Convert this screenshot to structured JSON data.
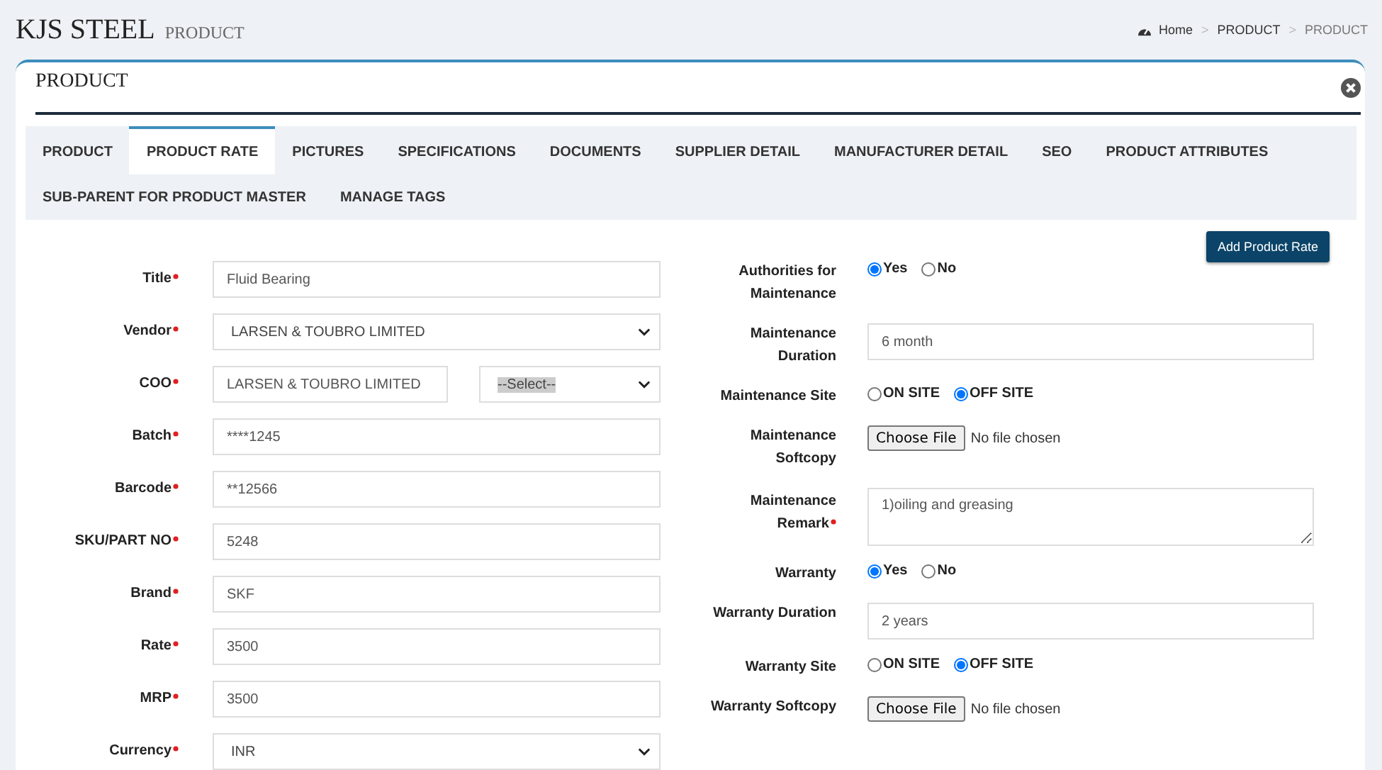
{
  "header": {
    "title": "KJS STEEL",
    "subtitle": "PRODUCT"
  },
  "breadcrumb": {
    "separator": ">",
    "items": [
      {
        "label": "Home",
        "kind": "home"
      },
      {
        "label": "PRODUCT",
        "kind": "link"
      },
      {
        "label": "PRODUCT",
        "kind": "current"
      }
    ]
  },
  "panel": {
    "title": "PRODUCT"
  },
  "tabs": [
    {
      "label": "PRODUCT",
      "selected": false
    },
    {
      "label": "PRODUCT RATE",
      "selected": true
    },
    {
      "label": "PICTURES",
      "selected": false
    },
    {
      "label": "SPECIFICATIONS",
      "selected": false
    },
    {
      "label": "DOCUMENTS",
      "selected": false
    },
    {
      "label": "SUPPLIER DETAIL",
      "selected": false
    },
    {
      "label": "MANUFACTURER DETAIL",
      "selected": false
    },
    {
      "label": "SEO",
      "selected": false
    },
    {
      "label": "PRODUCT ATTRIBUTES",
      "selected": false
    },
    {
      "label": "SUB-PARENT FOR PRODUCT MASTER",
      "selected": false
    },
    {
      "label": "MANAGE TAGS",
      "selected": false
    }
  ],
  "add_button": "Add Product Rate",
  "left_fields": [
    {
      "label": "Title",
      "required": true,
      "kind": "text",
      "value": "Fluid Bearing"
    },
    {
      "label": "Vendor",
      "required": true,
      "kind": "select",
      "value": "LARSEN & TOUBRO LIMITED"
    },
    {
      "label": "COO",
      "required": true,
      "kind": "text_select",
      "value": "LARSEN & TOUBRO LIMITED",
      "select_value": "--Select--"
    },
    {
      "label": "Batch",
      "required": true,
      "kind": "text",
      "value": "****1245"
    },
    {
      "label": "Barcode",
      "required": true,
      "kind": "text",
      "value": "**12566"
    },
    {
      "label": "SKU/PART NO",
      "required": true,
      "kind": "text",
      "value": "5248"
    },
    {
      "label": "Brand",
      "required": true,
      "kind": "text",
      "value": "SKF"
    },
    {
      "label": "Rate",
      "required": true,
      "kind": "text",
      "value": "3500"
    },
    {
      "label": "MRP",
      "required": true,
      "kind": "text",
      "value": "3500"
    },
    {
      "label": "Currency",
      "required": true,
      "kind": "select",
      "value": "INR"
    }
  ],
  "right_fields": [
    {
      "label": "Authorities for Maintenance",
      "required": false,
      "kind": "radio",
      "options": [
        {
          "label": "Yes",
          "selected": true
        },
        {
          "label": "No",
          "selected": false
        }
      ]
    },
    {
      "label": "Maintenance Duration",
      "required": false,
      "kind": "text",
      "value": "6 month"
    },
    {
      "label": "Maintenance Site",
      "required": false,
      "kind": "radio",
      "options": [
        {
          "label": "ON SITE",
          "selected": false
        },
        {
          "label": "OFF SITE",
          "selected": true
        }
      ]
    },
    {
      "label": "Maintenance Softcopy",
      "required": false,
      "kind": "file",
      "button": "Choose File",
      "status": "No file chosen"
    },
    {
      "label": "Maintenance Remark",
      "required": true,
      "kind": "textarea",
      "value": "1)oiling and greasing"
    },
    {
      "label": "Warranty",
      "required": false,
      "kind": "radio",
      "options": [
        {
          "label": "Yes",
          "selected": true
        },
        {
          "label": "No",
          "selected": false
        }
      ]
    },
    {
      "label": "Warranty Duration",
      "required": false,
      "kind": "text",
      "value": "2 years"
    },
    {
      "label": "Warranty Site",
      "required": false,
      "kind": "radio",
      "options": [
        {
          "label": "ON SITE",
          "selected": false
        },
        {
          "label": "OFF SITE",
          "selected": true
        }
      ]
    },
    {
      "label": "Warranty Softcopy",
      "required": false,
      "kind": "file",
      "button": "Choose File",
      "status": "No file chosen"
    }
  ]
}
